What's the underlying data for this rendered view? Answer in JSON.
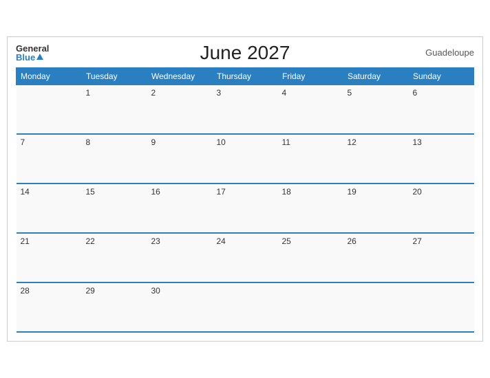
{
  "header": {
    "logo_general": "General",
    "logo_blue": "Blue",
    "title": "June 2027",
    "region": "Guadeloupe"
  },
  "weekdays": [
    "Monday",
    "Tuesday",
    "Wednesday",
    "Thursday",
    "Friday",
    "Saturday",
    "Sunday"
  ],
  "weeks": [
    [
      "",
      "1",
      "2",
      "3",
      "4",
      "5",
      "6"
    ],
    [
      "7",
      "8",
      "9",
      "10",
      "11",
      "12",
      "13"
    ],
    [
      "14",
      "15",
      "16",
      "17",
      "18",
      "19",
      "20"
    ],
    [
      "21",
      "22",
      "23",
      "24",
      "25",
      "26",
      "27"
    ],
    [
      "28",
      "29",
      "30",
      "",
      "",
      "",
      ""
    ]
  ]
}
